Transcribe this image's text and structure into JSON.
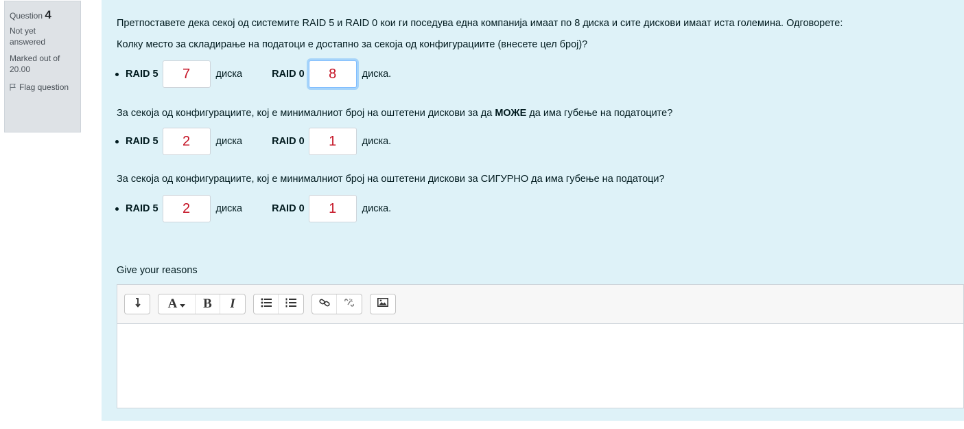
{
  "info": {
    "question_label": "Question",
    "question_number": "4",
    "state_line1": "Not yet",
    "state_line2": "answered",
    "grade_line1": "Marked out of",
    "grade_line2": "20.00",
    "flag_label": "Flag question"
  },
  "question": {
    "intro": "Претпоставете дека секој од системите RAID 5 и RAID 0 кои ги поседува една компанија имаат по 8 диска и сите дискови имаат иста големина. Одговорете:",
    "q1": "Колку место за складирање на податоци е достапно за секоја од конфигурациите (внесете цел број)?",
    "q2_before": "За секоја од конфигурациите, кој е минималниот број на оштетени дискови за да ",
    "q2_bold": "МОЖЕ",
    "q2_after": " да има губење на податоците?",
    "q3": "За секоја од конфигурациите, кој е минималниот број на оштетени дискови за СИГУРНО да има губење на податоци?",
    "raid5_label": "RAID 5",
    "raid0_label": "RAID 0",
    "unit_mid": "диска",
    "unit_end": "диска.",
    "answers": {
      "q1_raid5": "7",
      "q1_raid0": "8",
      "q2_raid5": "2",
      "q2_raid0": "1",
      "q3_raid5": "2",
      "q3_raid0": "1"
    }
  },
  "reasons_label": "Give your reasons",
  "editor": {
    "toolbar": [
      "toggle-icon",
      "font-color-icon",
      "bold-icon",
      "italic-icon",
      "unordered-list-icon",
      "ordered-list-icon",
      "link-icon",
      "unlink-icon",
      "image-icon"
    ],
    "bold_glyph": "B",
    "italic_glyph": "I",
    "font_glyph": "A",
    "content": ""
  }
}
